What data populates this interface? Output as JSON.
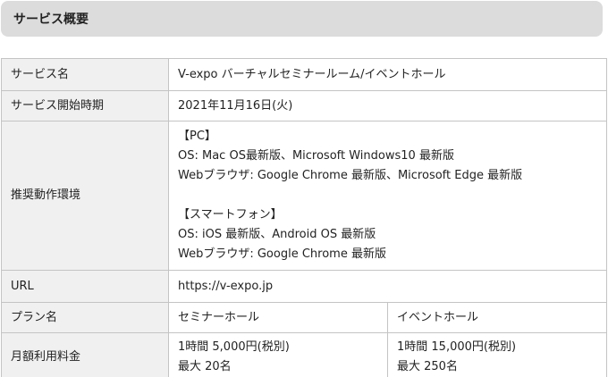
{
  "section": {
    "title": "サービス概要"
  },
  "rows": {
    "service_name": {
      "label": "サービス名",
      "value": "V-expo バーチャルセミナールーム/イベントホール"
    },
    "start_date": {
      "label": "サービス開始時期",
      "value": "2021年11月16日(火)"
    },
    "environment": {
      "label": "推奨動作環境",
      "pc_heading": "【PC】",
      "pc_os": "OS: Mac OS最新版、Microsoft Windows10 最新版",
      "pc_browser": "Webブラウザ: Google Chrome 最新版、Microsoft Edge 最新版",
      "sp_heading": "【スマートフォン】",
      "sp_os": "OS: iOS 最新版、Android OS 最新版",
      "sp_browser": "Webブラウザ: Google Chrome 最新版"
    },
    "url": {
      "label": "URL",
      "value": "https://v-expo.jp"
    },
    "plan": {
      "label": "プラン名",
      "plans": [
        "セミナーホール",
        "イベントホール"
      ]
    },
    "fee": {
      "label": "月額利用料金",
      "seminar": {
        "price": "1時間 5,000円(税別)",
        "capacity": "最大 20名"
      },
      "event": {
        "price": "1時間 15,000円(税別)",
        "capacity": "最大 250名"
      }
    }
  }
}
